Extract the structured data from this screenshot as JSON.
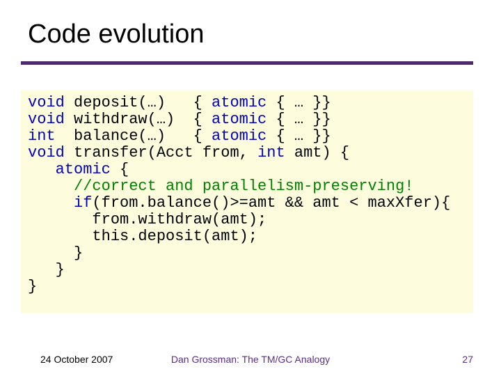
{
  "title": "Code evolution",
  "code": {
    "l1a": "void",
    "l1b": " deposit(…)   { ",
    "l1c": "atomic",
    "l1d": " { … }}",
    "l2a": "void",
    "l2b": " withdraw(…)  { ",
    "l2c": "atomic",
    "l2d": " { … }}",
    "l3a": "int",
    "l3b": "  balance(…)   { ",
    "l3c": "atomic",
    "l3d": " { … }}",
    "l4a": "void",
    "l4b": " transfer(Acct from, ",
    "l4c": "int",
    "l4d": " amt) {",
    "l5a": "   ",
    "l5b": "atomic",
    "l5c": " {",
    "l6": "     //correct and parallelism-preserving!",
    "l7a": "     ",
    "l7b": "if",
    "l7c": "(from.balance()>=amt && amt < maxXfer){",
    "l8": "       from.withdraw(amt);",
    "l9": "       this.deposit(amt);",
    "l10": "     }",
    "l11": "   }",
    "l12": "}"
  },
  "footer": {
    "date": "24 October 2007",
    "center": "Dan Grossman: The TM/GC Analogy",
    "page": "27"
  }
}
